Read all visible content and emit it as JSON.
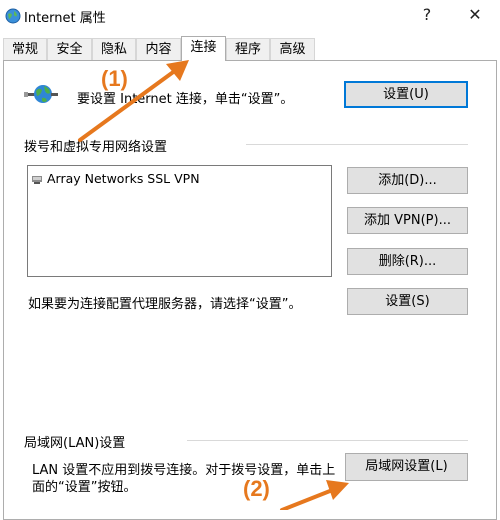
{
  "window": {
    "title": "Internet 属性",
    "help_glyph": "?",
    "close_glyph": "✕"
  },
  "tabs": [
    {
      "label": "常规"
    },
    {
      "label": "安全"
    },
    {
      "label": "隐私"
    },
    {
      "label": "内容"
    },
    {
      "label": "连接",
      "active": true
    },
    {
      "label": "程序"
    },
    {
      "label": "高级"
    }
  ],
  "setup": {
    "text": "要设置 Internet 连接，单击“设置”。",
    "button": "设置(U)"
  },
  "dialup": {
    "section_title": "拨号和虚拟专用网络设置",
    "list_items": [
      {
        "label": "Array Networks SSL VPN",
        "icon": "vpn-connection-icon"
      }
    ],
    "add_button": "添加(D)...",
    "add_vpn_button": "添加 VPN(P)...",
    "remove_button": "删除(R)..."
  },
  "proxy": {
    "text": "如果要为连接配置代理服务器，请选择“设置”。",
    "button": "设置(S)"
  },
  "lan": {
    "section_title": "局域网(LAN)设置",
    "text_line1": "LAN 设置不应用到拨号连接。对于拨号设置，单击上",
    "text_line2": "面的“设置”按钮。",
    "button": "局域网设置(L)"
  },
  "annotations": {
    "step1": "(1)",
    "step2": "(2)",
    "color": "#e6781e"
  }
}
